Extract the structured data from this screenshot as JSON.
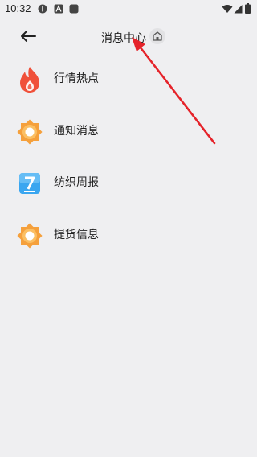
{
  "status_bar": {
    "time": "10:32",
    "icons": [
      "alert-icon",
      "a-icon",
      "square-icon",
      "wifi-icon",
      "signal-icon",
      "battery-icon"
    ]
  },
  "header": {
    "title": "消息中心",
    "back_icon": "back-arrow-icon",
    "home_icon": "home-icon"
  },
  "list": {
    "items": [
      {
        "label": "行情热点",
        "icon": "flame-icon"
      },
      {
        "label": "通知消息",
        "icon": "sun-icon"
      },
      {
        "label": "纺织周报",
        "icon": "weekly-7-icon"
      },
      {
        "label": "提货信息",
        "icon": "sun-icon"
      }
    ]
  },
  "colors": {
    "background": "#efeff1",
    "text": "#222222",
    "flame": "#f0503a",
    "sun_orange": "#f5a03c",
    "weekly_blue": "#3aa6f0",
    "annotation_arrow": "#e5232a"
  }
}
